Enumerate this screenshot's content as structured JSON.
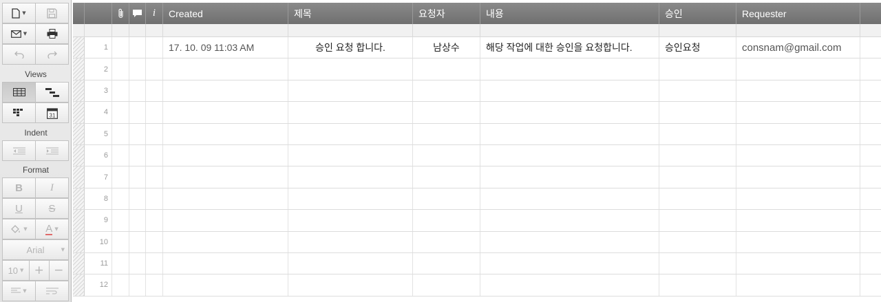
{
  "toolbar": {
    "views_label": "Views",
    "indent_label": "Indent",
    "format_label": "Format",
    "font_name": "Arial",
    "font_size": "10",
    "bold": "B",
    "italic": "I",
    "underline": "U",
    "strike": "S",
    "text_color": "A",
    "plus": "+",
    "minus": "−",
    "calendar_day": "31"
  },
  "columns": {
    "info": "i",
    "created": "Created",
    "title": "제목",
    "requester_kr": "요청자",
    "content": "내용",
    "approval": "승인",
    "requester": "Requester"
  },
  "rows": [
    {
      "num": "1",
      "created": "17. 10. 09 11:03 AM",
      "title": "승인 요청 합니다.",
      "requester_kr": "남상수",
      "content": "해당 작업에 대한 승인을 요청합니다.",
      "approval": "승인요청",
      "requester": "consnam@gmail.com"
    },
    {
      "num": "2",
      "created": "",
      "title": "",
      "requester_kr": "",
      "content": "",
      "approval": "",
      "requester": ""
    },
    {
      "num": "3",
      "created": "",
      "title": "",
      "requester_kr": "",
      "content": "",
      "approval": "",
      "requester": ""
    },
    {
      "num": "4",
      "created": "",
      "title": "",
      "requester_kr": "",
      "content": "",
      "approval": "",
      "requester": ""
    },
    {
      "num": "5",
      "created": "",
      "title": "",
      "requester_kr": "",
      "content": "",
      "approval": "",
      "requester": ""
    },
    {
      "num": "6",
      "created": "",
      "title": "",
      "requester_kr": "",
      "content": "",
      "approval": "",
      "requester": ""
    },
    {
      "num": "7",
      "created": "",
      "title": "",
      "requester_kr": "",
      "content": "",
      "approval": "",
      "requester": ""
    },
    {
      "num": "8",
      "created": "",
      "title": "",
      "requester_kr": "",
      "content": "",
      "approval": "",
      "requester": ""
    },
    {
      "num": "9",
      "created": "",
      "title": "",
      "requester_kr": "",
      "content": "",
      "approval": "",
      "requester": ""
    },
    {
      "num": "10",
      "created": "",
      "title": "",
      "requester_kr": "",
      "content": "",
      "approval": "",
      "requester": ""
    },
    {
      "num": "11",
      "created": "",
      "title": "",
      "requester_kr": "",
      "content": "",
      "approval": "",
      "requester": ""
    },
    {
      "num": "12",
      "created": "",
      "title": "",
      "requester_kr": "",
      "content": "",
      "approval": "",
      "requester": ""
    }
  ],
  "colors": {
    "header_bg": "#7c7c7c",
    "toolbar_bg": "#e6e6e6",
    "grid_line": "#dcdcdc",
    "text_color_underline": "#e06a6a"
  }
}
